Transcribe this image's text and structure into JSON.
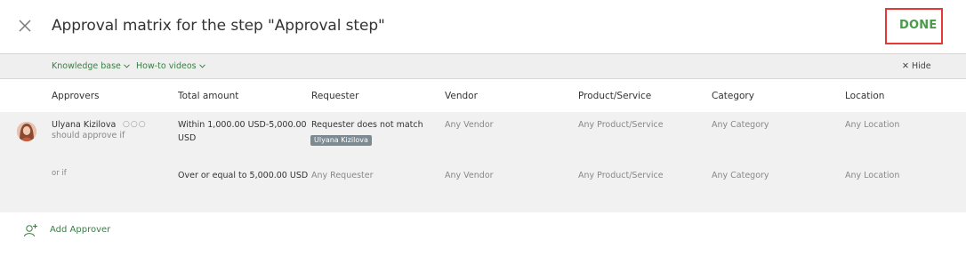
{
  "header": {
    "title": "Approval matrix for the step \"Approval step\"",
    "done_label": "DONE"
  },
  "toolbar": {
    "knowledge_base": "Knowledge base",
    "how_to_videos": "How-to videos",
    "hide_label": "Hide"
  },
  "table": {
    "columns": [
      "Approvers",
      "Total amount",
      "Requester",
      "Vendor",
      "Product/Service",
      "Category",
      "Location"
    ],
    "rows": [
      {
        "approver_name": "Ulyana Kizilova",
        "approver_note": "should approve if",
        "total_amount_line1": "Within 1,000.00 USD-5,000.00",
        "total_amount_line2": "USD",
        "requester": "Requester does not match",
        "requester_badge": "Ulyana Kizilova",
        "vendor": "Any Vendor",
        "product_service": "Any Product/Service",
        "category": "Any Category",
        "location": "Any Location"
      },
      {
        "condition_prefix": "or if",
        "total_amount": "Over or equal to 5,000.00 USD",
        "requester": "Any Requester",
        "vendor": "Any Vendor",
        "product_service": "Any Product/Service",
        "category": "Any Category",
        "location": "Any Location"
      }
    ]
  },
  "footer": {
    "add_approver_label": "Add Approver"
  },
  "icons": {
    "close": "close-icon",
    "chevron": "chevron-down-icon",
    "more": "more-options-icon",
    "add_user": "add-user-icon"
  },
  "colors": {
    "accent_green": "#3a7d44",
    "done_green": "#4a9a4a",
    "highlight_red": "#e53935",
    "badge_gray": "#7d8a92"
  }
}
